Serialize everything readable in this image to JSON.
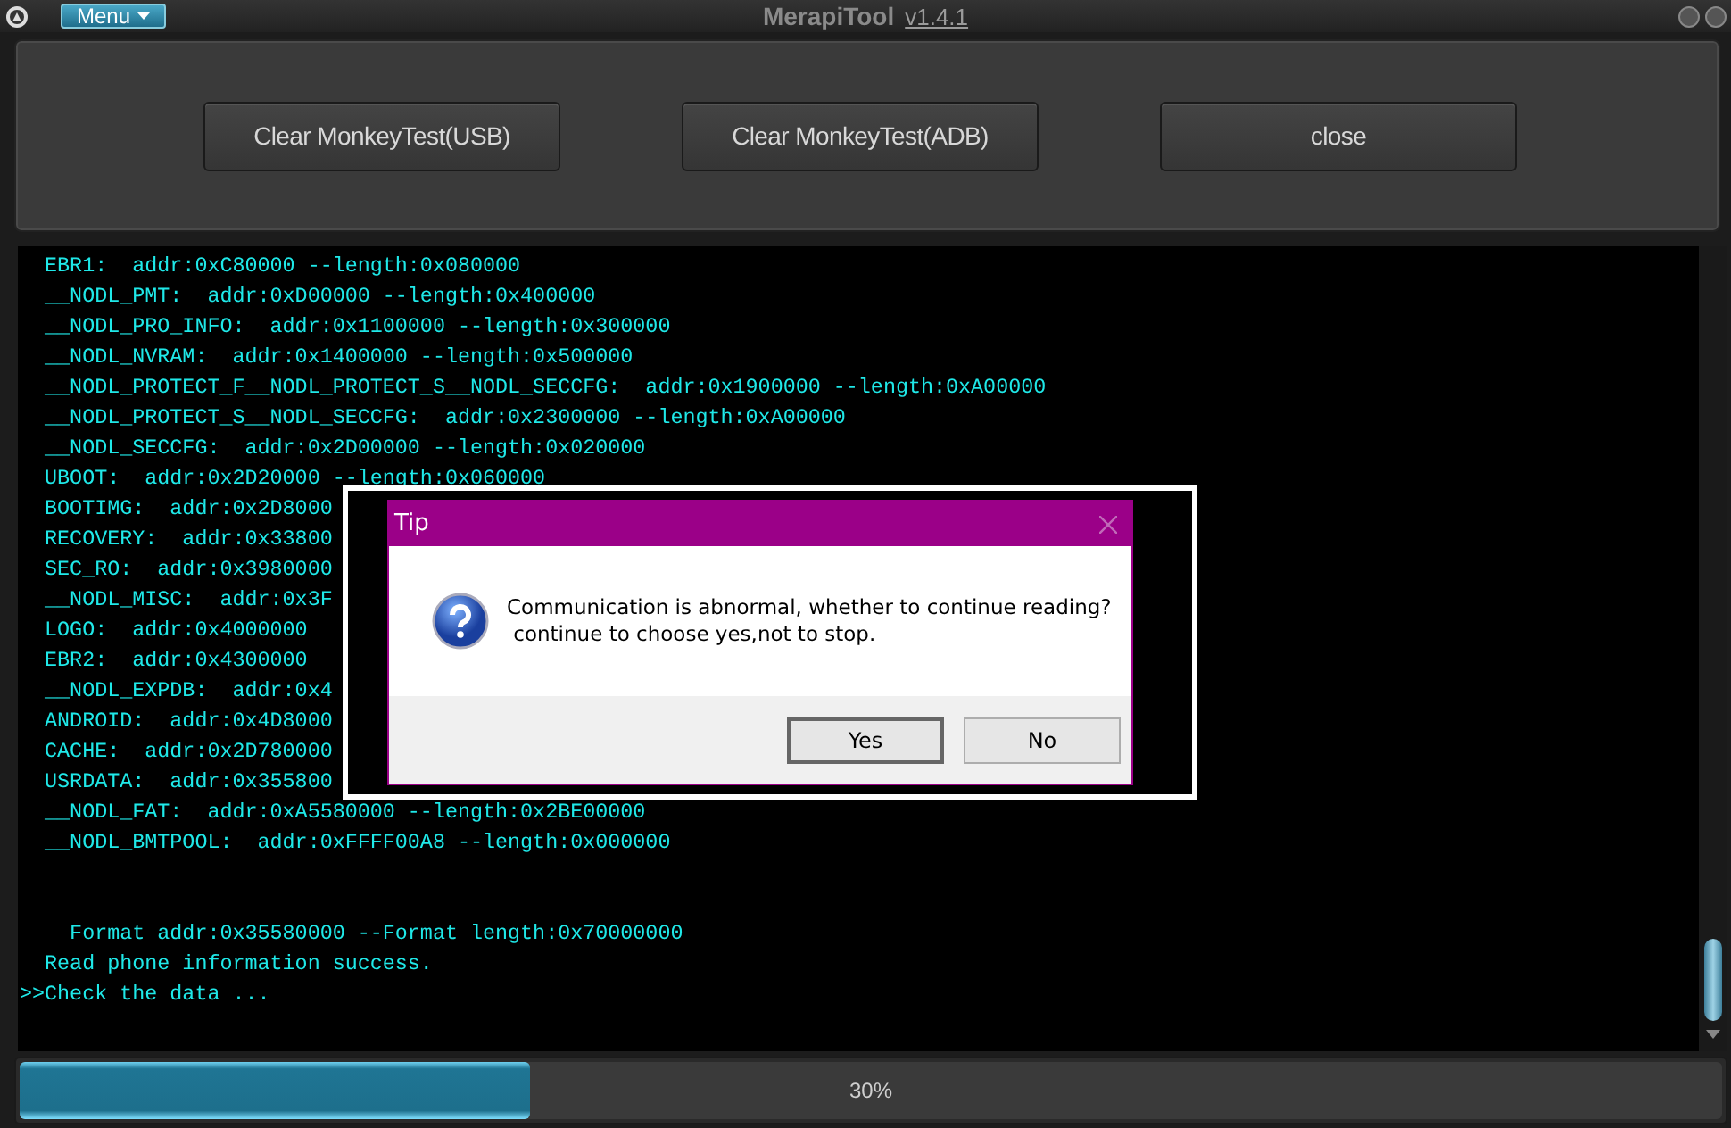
{
  "window": {
    "menu": "Menu",
    "title": "MerapiTool",
    "version": "v1.4.1"
  },
  "toolbar": {
    "buttons": [
      "Clear MonkeyTest(USB)",
      "Clear MonkeyTest(ADB)",
      "close"
    ]
  },
  "console": {
    "lines": [
      "  EBR1:  addr:0xC80000 --length:0x080000",
      "  __NODL_PMT:  addr:0xD00000 --length:0x400000",
      "  __NODL_PRO_INFO:  addr:0x1100000 --length:0x300000",
      "  __NODL_NVRAM:  addr:0x1400000 --length:0x500000",
      "  __NODL_PROTECT_F__NODL_PROTECT_S__NODL_SECCFG:  addr:0x1900000 --length:0xA00000",
      "  __NODL_PROTECT_S__NODL_SECCFG:  addr:0x2300000 --length:0xA00000",
      "  __NODL_SECCFG:  addr:0x2D00000 --length:0x020000",
      "  UBOOT:  addr:0x2D20000 --length:0x060000",
      "  BOOTIMG:  addr:0x2D8000",
      "  RECOVERY:  addr:0x33800",
      "  SEC_RO:  addr:0x3980000",
      "  __NODL_MISC:  addr:0x3F",
      "  LOGO:  addr:0x4000000",
      "  EBR2:  addr:0x4300000",
      "  __NODL_EXPDB:  addr:0x4",
      "  ANDROID:  addr:0x4D8000",
      "  CACHE:  addr:0x2D780000",
      "  USRDATA:  addr:0x355800",
      "  __NODL_FAT:  addr:0xA5580000 --length:0x2BE00000",
      "  __NODL_BMTPOOL:  addr:0xFFFF00A8 --length:0x000000"
    ],
    "summary": [
      "    Format addr:0x35580000 --Format length:0x70000000",
      "  Read phone information success.",
      ">>Check the data ..."
    ]
  },
  "progress": {
    "level": 0.3,
    "reading": "30%"
  },
  "dialog": {
    "title": "Tip",
    "message": [
      "Communication is abnormal, whether to continue reading?",
      " continue to choose yes,not to stop."
    ],
    "buttons": [
      {
        "label": "Yes",
        "selected": true
      },
      {
        "label": "No",
        "selected": false
      }
    ]
  }
}
